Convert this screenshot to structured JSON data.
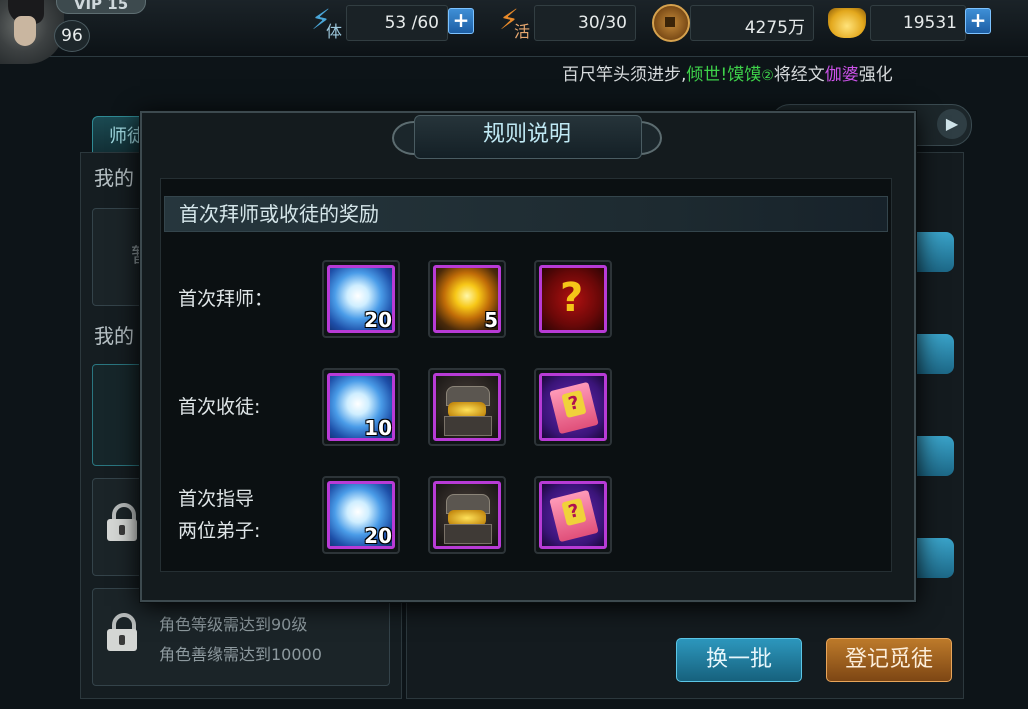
{
  "player": {
    "vip": "VIP 15",
    "level": "96"
  },
  "resources": {
    "stamina": {
      "label": "体",
      "value": "53 /60"
    },
    "vigor": {
      "label": "活",
      "value": "30/30"
    },
    "copper": {
      "value": "4275万"
    },
    "ingot": {
      "value": "19531"
    },
    "plus": "+"
  },
  "marquee": {
    "part1": "百尺竿头须进步,",
    "player_name": "倾世!馍馍",
    "player_rank": "②",
    "part2": "将经文",
    "item_name": "伽婆",
    "part3": "强化"
  },
  "background": {
    "tab_label": "师徒",
    "arrow": "▶",
    "my_label_1": "我的",
    "my_label_2": "我的",
    "slot_char": "暂",
    "req_level": "角色等级需达到90级",
    "req_karma": "角色善缘需达到10000",
    "refresh_button": "换一批",
    "register_button": "登记觅徒"
  },
  "modal": {
    "title": "规则说明",
    "section_title": "首次拜师或收徒的奖励",
    "rows": [
      {
        "label": "首次拜师：",
        "items": [
          {
            "icon": "blue-pearl-icon",
            "qty": "20"
          },
          {
            "icon": "golden-orb-icon",
            "qty": "5"
          },
          {
            "icon": "mystery-box-icon",
            "qty": ""
          }
        ]
      },
      {
        "label": "首次收徒:",
        "items": [
          {
            "icon": "blue-pearl-icon",
            "qty": "10"
          },
          {
            "icon": "treasure-chest-icon",
            "qty": ""
          },
          {
            "icon": "mystery-scroll-icon",
            "qty": ""
          }
        ]
      },
      {
        "label_line1": "首次指导",
        "label_line2": "两位弟子:",
        "items": [
          {
            "icon": "blue-pearl-icon",
            "qty": "20"
          },
          {
            "icon": "treasure-chest-icon",
            "qty": ""
          },
          {
            "icon": "mystery-scroll-icon",
            "qty": ""
          }
        ]
      }
    ]
  },
  "colors": {
    "accent_teal": "#2f8a94",
    "item_frame_purple": "#b83bd6",
    "name_green": "#3ed24a",
    "item_purple": "#cc52e8"
  }
}
